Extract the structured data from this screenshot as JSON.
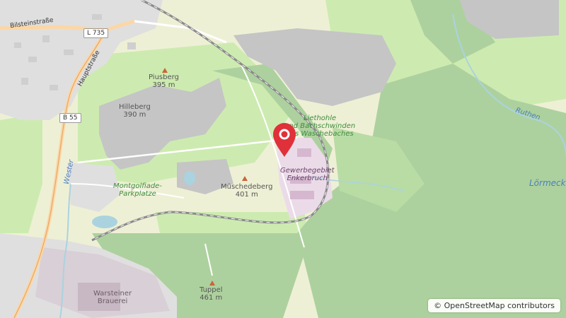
{
  "map": {
    "labels": {
      "bilsteinstrasse": "Bilsteinstraße",
      "l735": "L 735",
      "hauptstrasse": "Hauptstraße",
      "b55": "B 55",
      "wester": "Wester",
      "ruthen": "Ruthen",
      "lormecke": "Lörmecke",
      "liethohle": "Liethohle\nund Bachschwinden\ndes Waschebaches",
      "montgolfiade": "Montgolfiade-\nParkplatze",
      "gewerbegebiet": "Gewerbegebiet\nEnkerbruch",
      "brauerei": "Warsteiner\nBrauerei"
    },
    "peaks": [
      {
        "name": "Piusberg",
        "elevation": "395 m"
      },
      {
        "name": "Hilleberg",
        "elevation": "390 m"
      },
      {
        "name": "Müschedeberg",
        "elevation": "401 m"
      },
      {
        "name": "Tuppel",
        "elevation": "461 m"
      }
    ],
    "colors": {
      "forest": "#add19e",
      "meadow": "#cdebb0",
      "farmland": "#eef0d5",
      "quarry": "#c5c5c5",
      "residential": "#e0dfdf",
      "industrial": "#ebdbe8",
      "water": "#aad3df",
      "pin": "#e0303a"
    },
    "marker_icon": "map-pin-icon"
  },
  "attribution": {
    "symbol": "©",
    "text": "OpenStreetMap contributors"
  }
}
